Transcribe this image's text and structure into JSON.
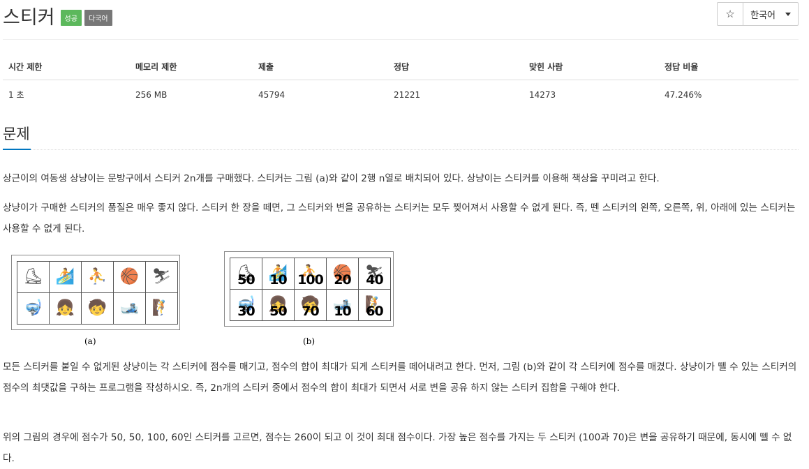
{
  "header": {
    "title": "스티커",
    "badges": [
      {
        "label": "성공",
        "color": "#5cb85c"
      },
      {
        "label": "다국어",
        "color": "#777777"
      }
    ],
    "star_icon": "☆",
    "language": "한국어"
  },
  "info_table": {
    "headers": [
      "시간 제한",
      "메모리 제한",
      "제출",
      "정답",
      "맞힌 사람",
      "정답 비율"
    ],
    "row": [
      "1 초",
      "256 MB",
      "45794",
      "21221",
      "14273",
      "47.246%"
    ]
  },
  "problem": {
    "heading": "문제",
    "paragraphs": [
      "상근이의 여동생 상냥이는 문방구에서 스티커 2n개를 구매했다. 스티커는 그림 (a)와 같이 2행 n열로 배치되어 있다. 상냥이는 스티커를 이용해 책상을 꾸미려고 한다.",
      "상냥이가 구매한 스티커의 품질은 매우 좋지 않다. 스티커 한 장을 떼면, 그 스티커와 변을 공유하는 스티커는 모두 찢어져서 사용할 수 없게 된다. 즉, 뗀 스티커의 왼쪽, 오른쪽, 위, 아래에 있는 스티커는 사용할 수 없게 된다.",
      "모든 스티커를 붙일 수 없게된 상냥이는 각 스티커에 점수를 매기고, 점수의 합이 최대가 되게 스티커를 떼어내려고 한다. 먼저, 그림 (b)와 같이 각 스티커에 점수를 매겼다. 상냥이가 뗄 수 있는 스티커의 점수의 최댓값을 구하는 프로그램을 작성하시오. 즉, 2n개의 스티커 중에서 점수의 합이 최대가 되면서 서로 변을 공유 하지 않는 스티커 집합을 구해야 한다.",
      "위의 그림의 경우에 점수가 50, 50, 100, 60인 스티커를 고르면, 점수는 260이 되고 이 것이 최대 점수이다. 가장 높은 점수를 가지는 두 스티커 (100과 70)은 변을 공유하기 때문에, 동시에 뗄 수 없다."
    ]
  },
  "figures": {
    "a_label": "(a)",
    "b_label": "(b)",
    "sticker_icons": [
      "⛸",
      "🏄",
      "⛹",
      "🏀",
      "⛷",
      "🤿",
      "👧",
      "🧒",
      "🎿",
      "🧗"
    ],
    "b_scores": [
      "50",
      "10",
      "100",
      "20",
      "40",
      "30",
      "50",
      "70",
      "10",
      "60"
    ]
  }
}
